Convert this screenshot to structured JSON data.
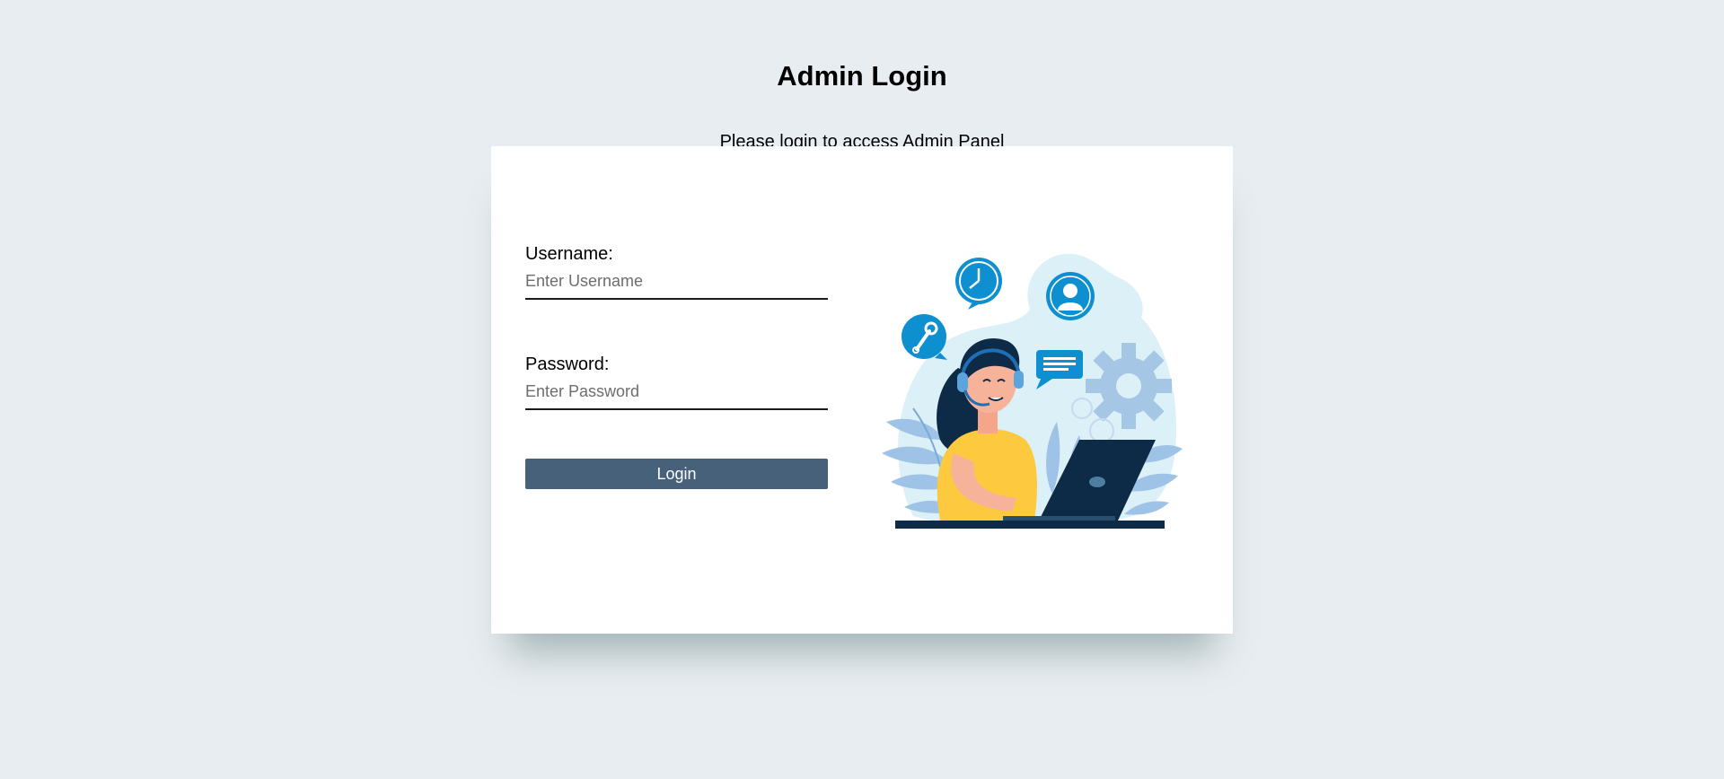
{
  "header": {
    "title": "Admin Login",
    "subtitle": "Please login to access Admin Panel"
  },
  "form": {
    "username_label": "Username:",
    "username_placeholder": "Enter Username",
    "username_value": "",
    "password_label": "Password:",
    "password_placeholder": "Enter Password",
    "password_value": "",
    "login_button": "Login"
  },
  "illustration": {
    "icons": [
      "clock-icon",
      "user-icon",
      "wrench-icon",
      "chat-icon",
      "gear-icon",
      "headset-icon",
      "laptop-icon"
    ]
  },
  "colors": {
    "background": "#e8edf1",
    "card": "#ffffff",
    "button": "#466179",
    "accent_blue": "#0e8fcf",
    "shirt_yellow": "#fcc93f",
    "laptop_navy": "#0d2a47"
  }
}
